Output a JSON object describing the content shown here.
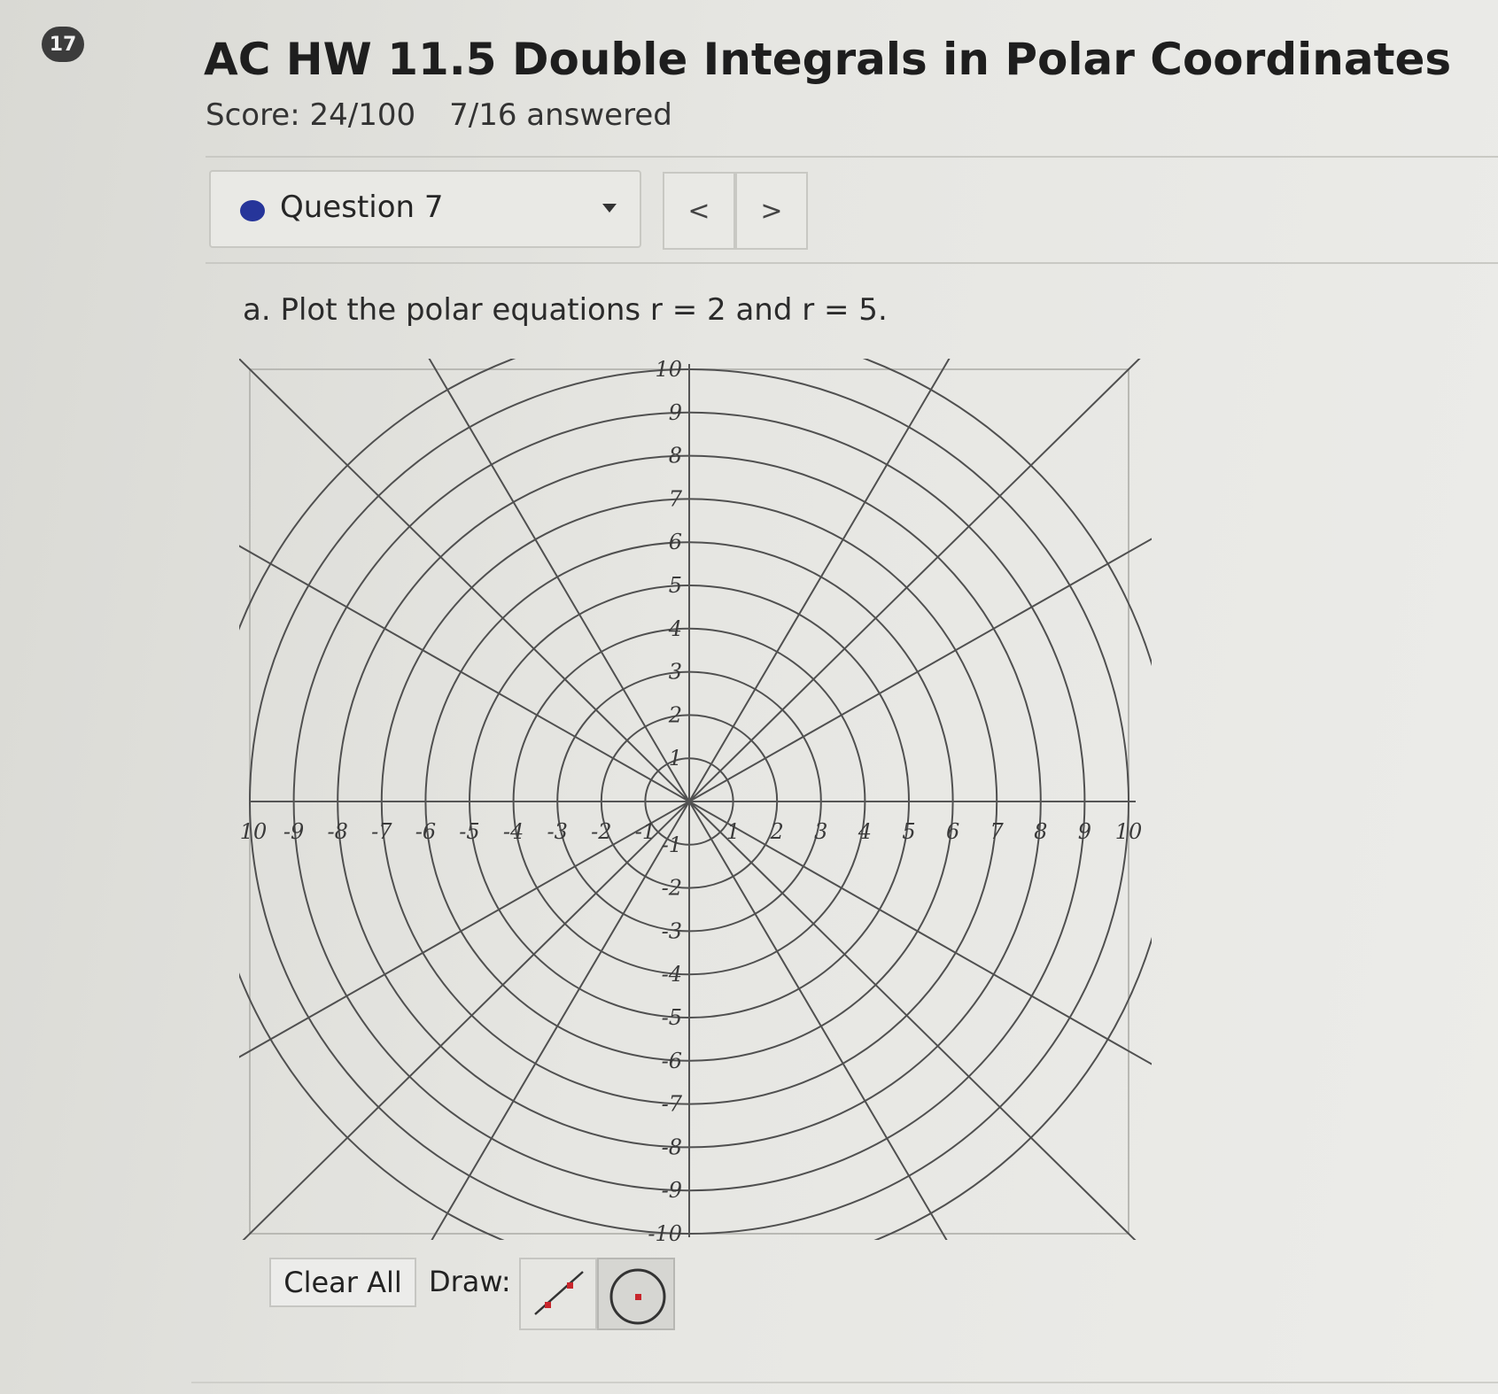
{
  "header": {
    "question_number": "17",
    "title": "AC HW 11.5 Double Integrals in Polar Coordinates",
    "score": "Score: 24/100",
    "answered": "7/16 answered"
  },
  "question_nav": {
    "selected": "Question 7",
    "prev_label": "<",
    "next_label": ">",
    "status_color": "#26359a"
  },
  "question": {
    "prompt": "a. Plot the polar equations r = 2 and r = 5."
  },
  "polar_grid": {
    "x_ticks": [
      "-10",
      "-9",
      "-8",
      "-7",
      "-6",
      "-5",
      "-4",
      "-3",
      "-2",
      "-1",
      "1",
      "2",
      "3",
      "4",
      "5",
      "6",
      "7",
      "8",
      "9",
      "10"
    ],
    "y_ticks": [
      "10",
      "9",
      "8",
      "7",
      "6",
      "5",
      "4",
      "3",
      "2",
      "1",
      "-1",
      "-2",
      "-3",
      "-4",
      "-5",
      "-6",
      "-7",
      "-8",
      "-9",
      "-10"
    ],
    "x_range": [
      -10,
      10
    ],
    "y_range": [
      -10,
      10
    ],
    "circle_radii": [
      1,
      2,
      3,
      4,
      5,
      6,
      7,
      8,
      9,
      10,
      11
    ],
    "ray_angles_deg": [
      0,
      30,
      45,
      60,
      90,
      120,
      135,
      150,
      180,
      210,
      225,
      240,
      270,
      300,
      315,
      330
    ]
  },
  "toolbar": {
    "clear_label": "Clear All",
    "draw_label": "Draw:",
    "tools": [
      "line-segment-icon",
      "circle-icon"
    ],
    "tool_accent": "#c8262c"
  }
}
